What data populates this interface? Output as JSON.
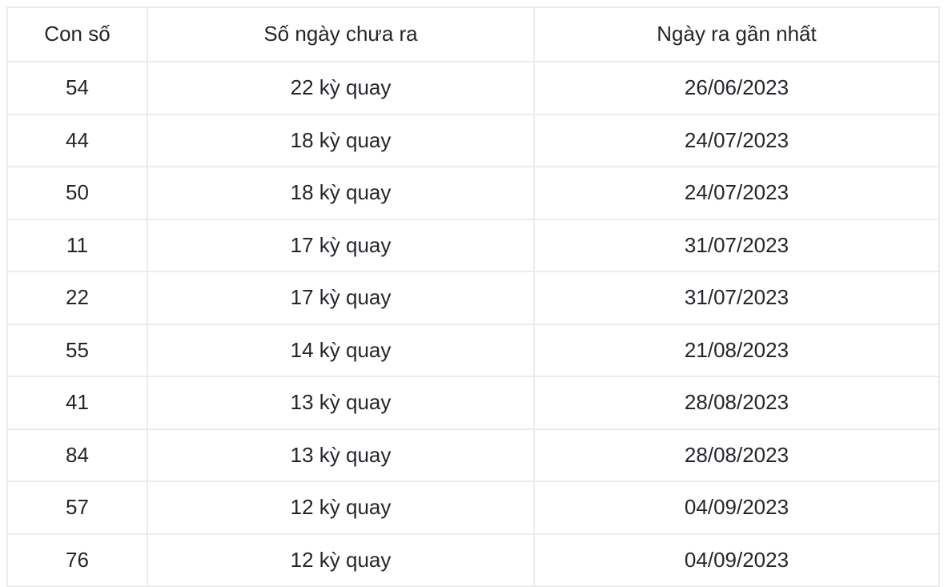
{
  "table": {
    "name": "lottery-overdue-numbers-table",
    "accent_color": "#e8291d",
    "text_color": "#24262b",
    "border_color": "#ececee",
    "columns": [
      {
        "key": "number",
        "label": "Con số"
      },
      {
        "key": "days_missing",
        "label": "Số ngày chưa ra"
      },
      {
        "key": "last_date",
        "label": "Ngày ra gần nhất"
      }
    ],
    "rows": [
      {
        "number": "54",
        "days_missing": "22 kỳ quay",
        "last_date": "26/06/2023"
      },
      {
        "number": "44",
        "days_missing": "18 kỳ quay",
        "last_date": "24/07/2023"
      },
      {
        "number": "50",
        "days_missing": "18 kỳ quay",
        "last_date": "24/07/2023"
      },
      {
        "number": "11",
        "days_missing": "17 kỳ quay",
        "last_date": "31/07/2023"
      },
      {
        "number": "22",
        "days_missing": "17 kỳ quay",
        "last_date": "31/07/2023"
      },
      {
        "number": "55",
        "days_missing": "14 kỳ quay",
        "last_date": "21/08/2023"
      },
      {
        "number": "41",
        "days_missing": "13 kỳ quay",
        "last_date": "28/08/2023"
      },
      {
        "number": "84",
        "days_missing": "13 kỳ quay",
        "last_date": "28/08/2023"
      },
      {
        "number": "57",
        "days_missing": "12 kỳ quay",
        "last_date": "04/09/2023"
      },
      {
        "number": "76",
        "days_missing": "12 kỳ quay",
        "last_date": "04/09/2023"
      }
    ]
  }
}
